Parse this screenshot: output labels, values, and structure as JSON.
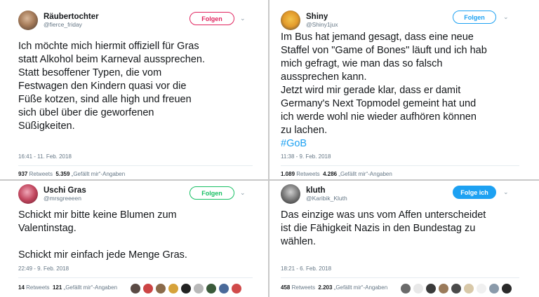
{
  "tweets": [
    {
      "display_name": "Räubertochter",
      "handle": "@fierce_friday",
      "follow_label": "Folgen",
      "text": "Ich möchte mich hiermit offiziell für Gras\nstatt Alkohol beim Karneval aussprechen.\nStatt besoffener Typen, die vom\nFestwagen den Kindern quasi vor die\nFüße kotzen, sind alle high und freuen\nsich übel über die geworfenen\nSüßigkeiten.",
      "timestamp": "16:41 - 11. Feb. 2018",
      "retweets_count": "937",
      "retweets_label": "Retweets",
      "likes_count": "5.359",
      "likes_label": "„Gefällt mir“-Angaben"
    },
    {
      "display_name": "Shiny",
      "handle": "@Shiny1jux",
      "follow_label": "Folgen",
      "text": "Im Bus hat jemand gesagt, dass eine neue\nStaffel von \"Game of Bones\" läuft und ich hab\nmich gefragt, wie man das so falsch\naussprechen kann.\nJetzt wird mir gerade klar, dass er damit\nGermany's Next Topmodel gemeint hat und\nich werde wohl nie wieder aufhören können\nzu lachen.",
      "hashtag": "#GoB",
      "timestamp": "11:38 - 9. Feb. 2018",
      "retweets_count": "1.089",
      "retweets_label": "Retweets",
      "likes_count": "4.286",
      "likes_label": "„Gefällt mir“-Angaben"
    },
    {
      "display_name": "Uschi Gras",
      "handle": "@mrsgreeeen",
      "follow_label": "Folgen",
      "text": "Schickt mir bitte keine Blumen zum\nValentinstag.\n\nSchickt mir einfach jede Menge Gras.",
      "timestamp": "22:49 - 9. Feb. 2018",
      "retweets_count": "14",
      "retweets_label": "Retweets",
      "likes_count": "121",
      "likes_label": "„Gefällt mir“-Angaben"
    },
    {
      "display_name": "kluth",
      "handle": "@Karibik_Kluth",
      "follow_label": "Folge ich",
      "text": "Das einzige was uns vom Affen unterscheidet\nist die Fähigkeit Nazis in den Bundestag zu\nwählen.",
      "timestamp": "18:21 - 6. Feb. 2018",
      "retweets_count": "458",
      "retweets_label": "Retweets",
      "likes_count": "2.203",
      "likes_label": "„Gefällt mir“-Angaben"
    }
  ],
  "icons": {
    "chevron": "chevron-down-icon",
    "avatar": "avatar"
  },
  "colors": {
    "link": "#1da1f2",
    "follow_red": "#e0245e",
    "follow_green": "#17bf63",
    "text_secondary": "#657786"
  }
}
